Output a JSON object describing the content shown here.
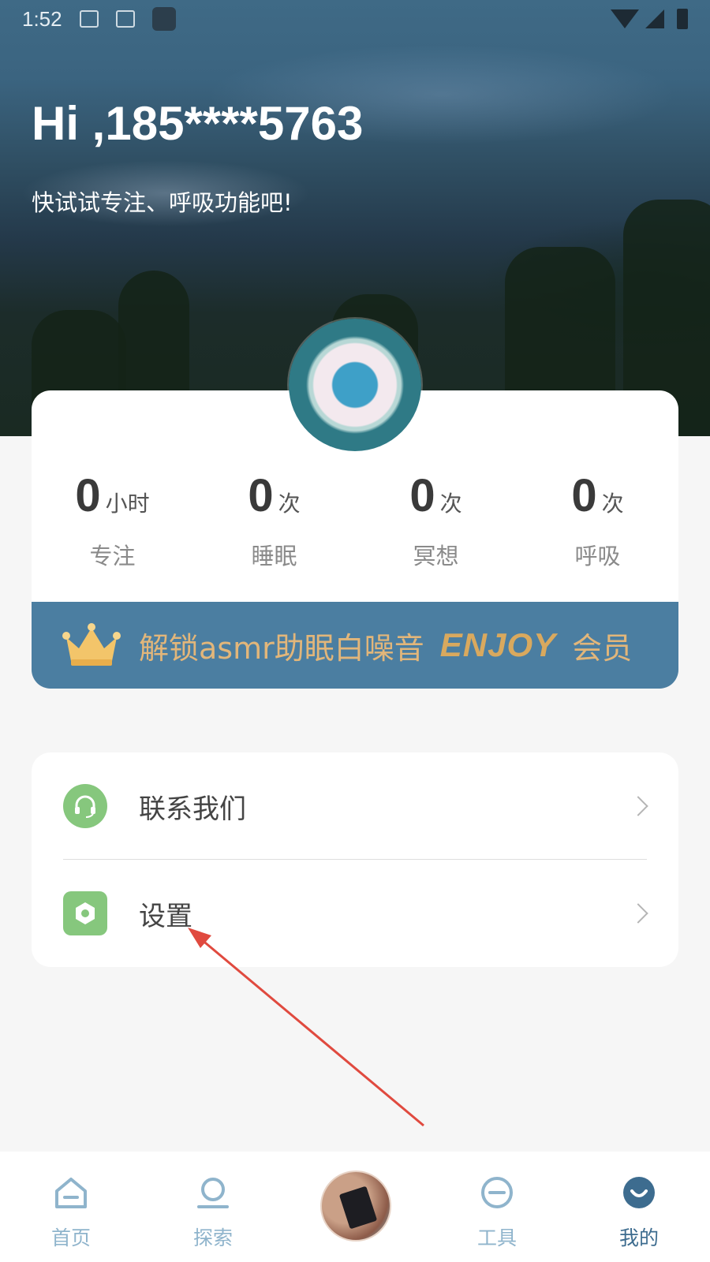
{
  "status_bar": {
    "time": "1:52",
    "icons": [
      "image-icon",
      "font-icon",
      "app-icon",
      "wifi-icon",
      "signal-icon",
      "battery-icon"
    ]
  },
  "header": {
    "greeting": "Hi ,185****5763",
    "subtitle": "快试试专注、呼吸功能吧!"
  },
  "stats": [
    {
      "value": "0",
      "unit": "小时",
      "label": "专注"
    },
    {
      "value": "0",
      "unit": "次",
      "label": "睡眠"
    },
    {
      "value": "0",
      "unit": "次",
      "label": "冥想"
    },
    {
      "value": "0",
      "unit": "次",
      "label": "呼吸"
    }
  ],
  "vip_banner": {
    "text": "解锁asmr助眠白噪音",
    "enjoy": "ENJOY",
    "member": "会员",
    "icon": "crown-icon"
  },
  "menu": {
    "items": [
      {
        "label": "联系我们",
        "icon": "headset-icon"
      },
      {
        "label": "设置",
        "icon": "settings-hex-icon"
      }
    ]
  },
  "bottom_nav": {
    "items": [
      {
        "label": "首页",
        "icon": "home-icon",
        "active": false
      },
      {
        "label": "探索",
        "icon": "explore-icon",
        "active": false
      },
      {
        "label": "",
        "icon": "player-disc-icon",
        "active": false
      },
      {
        "label": "工具",
        "icon": "tools-icon",
        "active": false
      },
      {
        "label": "我的",
        "icon": "profile-icon",
        "active": true
      }
    ]
  },
  "colors": {
    "accent": "#4b7ea1",
    "vip_text": "#e2b67a",
    "menu_icon_green": "#86c77d",
    "nav_inactive": "#8fb4cc",
    "nav_active": "#3d6c8f",
    "annotation_arrow": "#e04a3f"
  }
}
